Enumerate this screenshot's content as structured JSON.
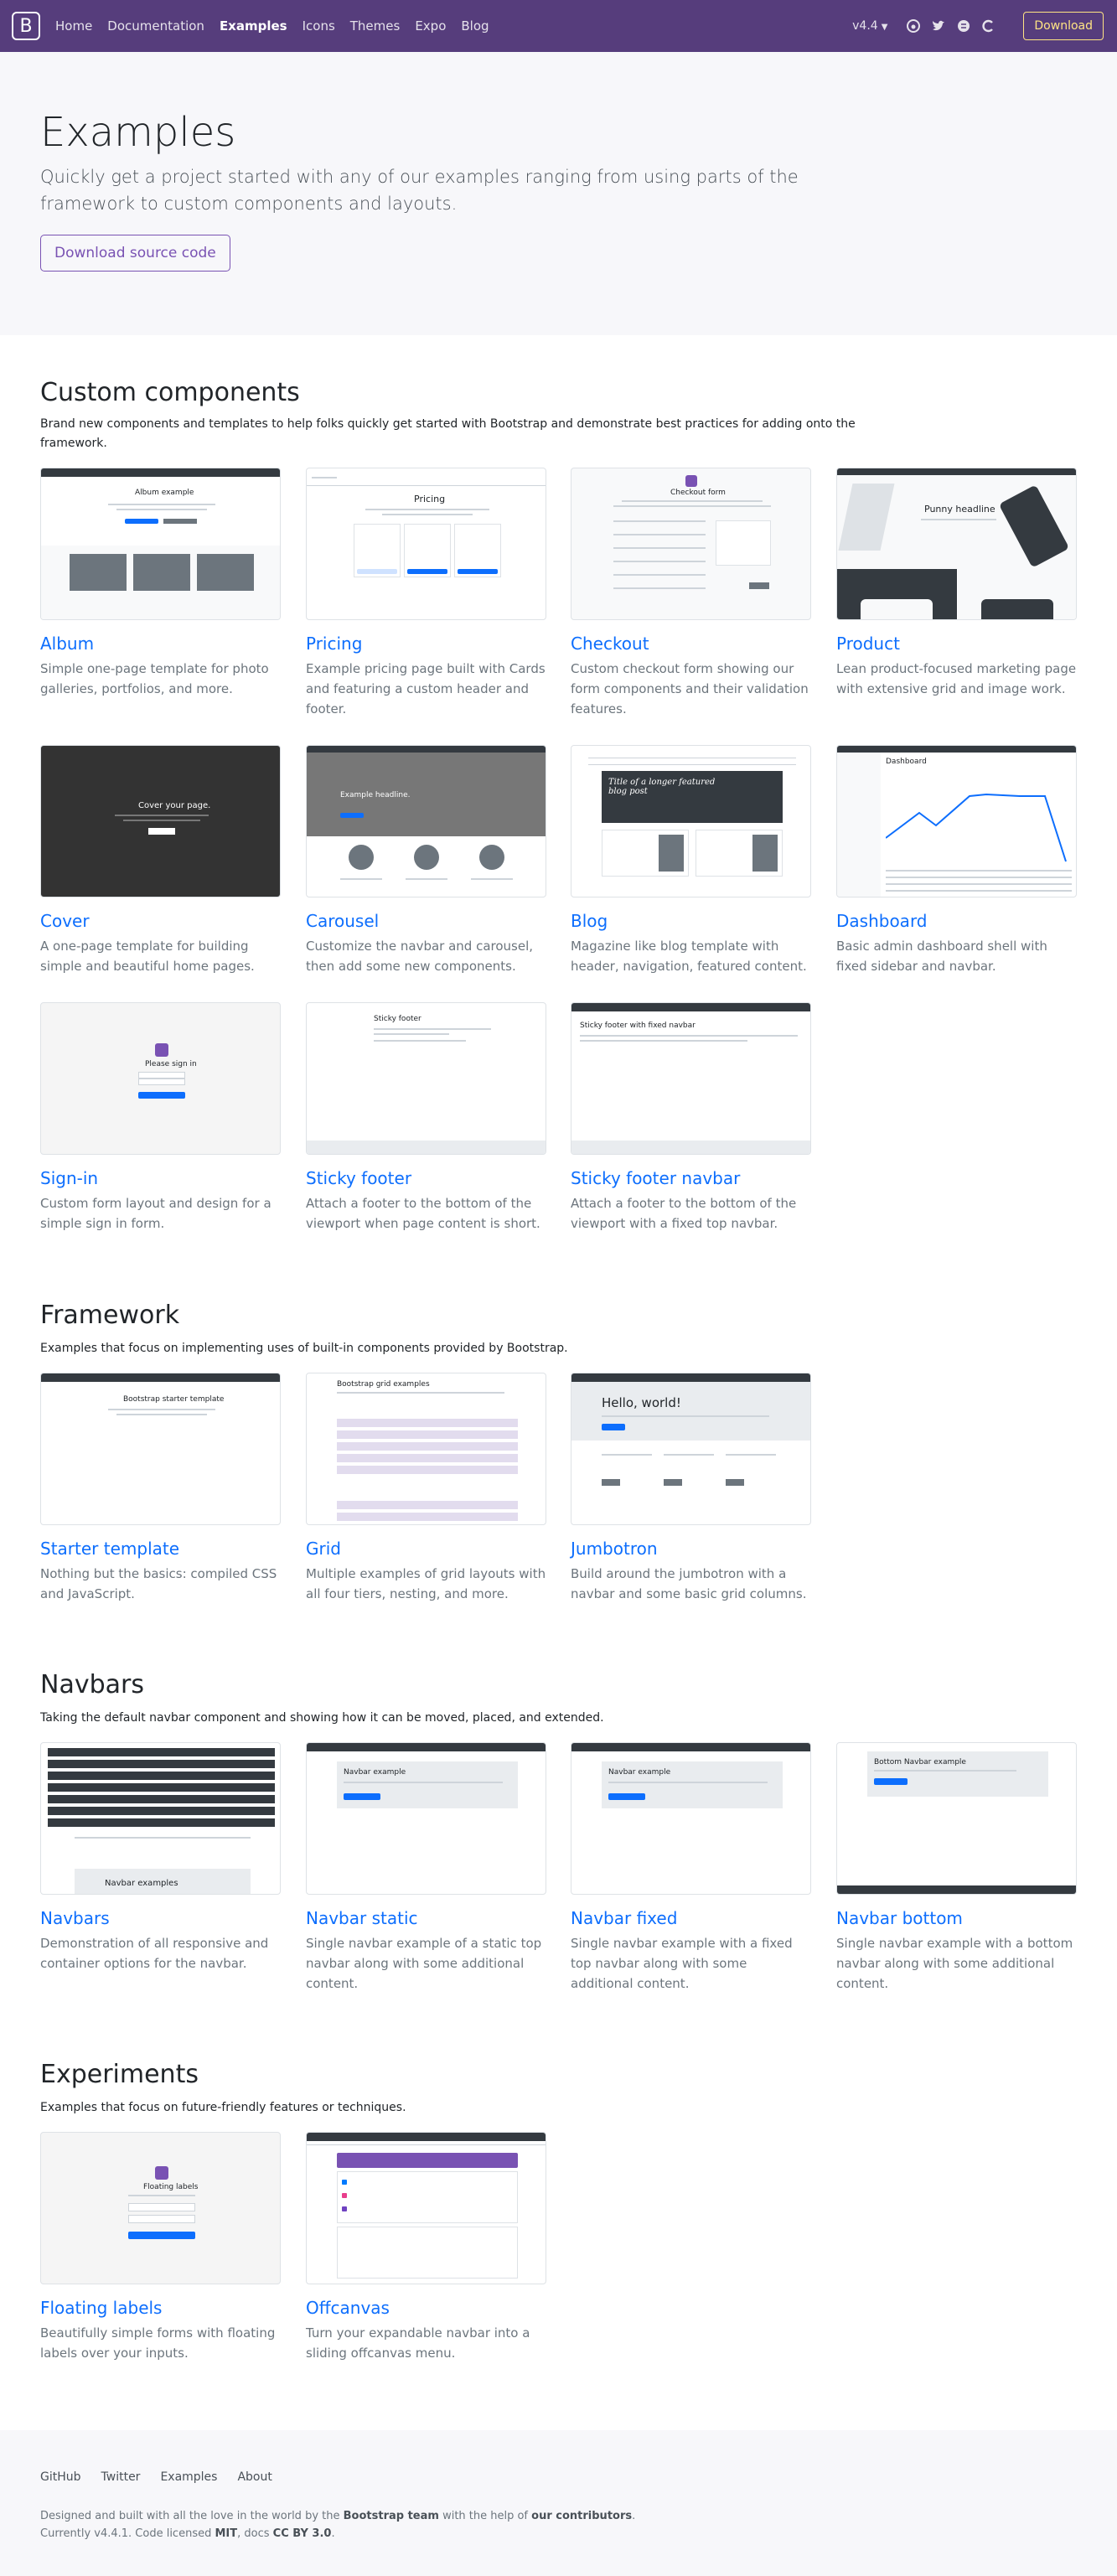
{
  "navbar": {
    "brand": "B",
    "links": [
      "Home",
      "Documentation",
      "Examples",
      "Icons",
      "Themes",
      "Expo",
      "Blog"
    ],
    "version": "v4.4",
    "download": "Download"
  },
  "hero": {
    "title": "Examples",
    "lead": "Quickly get a project started with any of our examples ranging from using parts of the framework to custom components and layouts.",
    "button": "Download source code"
  },
  "sections": {
    "custom": {
      "title": "Custom components",
      "desc": "Brand new components and templates to help folks quickly get started with Bootstrap and demonstrate best practices for adding onto the framework.",
      "cards": [
        {
          "title": "Album",
          "desc": "Simple one-page template for photo galleries, portfolios, and more."
        },
        {
          "title": "Pricing",
          "desc": "Example pricing page built with Cards and featuring a custom header and footer."
        },
        {
          "title": "Checkout",
          "desc": "Custom checkout form showing our form components and their validation features."
        },
        {
          "title": "Product",
          "desc": "Lean product-focused marketing page with extensive grid and image work."
        },
        {
          "title": "Cover",
          "desc": "A one-page template for building simple and beautiful home pages."
        },
        {
          "title": "Carousel",
          "desc": "Customize the navbar and carousel, then add some new components."
        },
        {
          "title": "Blog",
          "desc": "Magazine like blog template with header, navigation, featured content."
        },
        {
          "title": "Dashboard",
          "desc": "Basic admin dashboard shell with fixed sidebar and navbar."
        },
        {
          "title": "Sign-in",
          "desc": "Custom form layout and design for a simple sign in form."
        },
        {
          "title": "Sticky footer",
          "desc": "Attach a footer to the bottom of the viewport when page content is short."
        },
        {
          "title": "Sticky footer navbar",
          "desc": "Attach a footer to the bottom of the viewport with a fixed top navbar."
        }
      ]
    },
    "framework": {
      "title": "Framework",
      "desc": "Examples that focus on implementing uses of built-in components provided by Bootstrap.",
      "cards": [
        {
          "title": "Starter template",
          "desc": "Nothing but the basics: compiled CSS and JavaScript."
        },
        {
          "title": "Grid",
          "desc": "Multiple examples of grid layouts with all four tiers, nesting, and more."
        },
        {
          "title": "Jumbotron",
          "desc": "Build around the jumbotron with a navbar and some basic grid columns."
        }
      ]
    },
    "navbars": {
      "title": "Navbars",
      "desc": "Taking the default navbar component and showing how it can be moved, placed, and extended.",
      "cards": [
        {
          "title": "Navbars",
          "desc": "Demonstration of all responsive and container options for the navbar."
        },
        {
          "title": "Navbar static",
          "desc": "Single navbar example of a static top navbar along with some additional content."
        },
        {
          "title": "Navbar fixed",
          "desc": "Single navbar example with a fixed top navbar along with some additional content."
        },
        {
          "title": "Navbar bottom",
          "desc": "Single navbar example with a bottom navbar along with some additional content."
        }
      ]
    },
    "experiments": {
      "title": "Experiments",
      "desc": "Examples that focus on future-friendly features or techniques.",
      "cards": [
        {
          "title": "Floating labels",
          "desc": "Beautifully simple forms with floating labels over your inputs."
        },
        {
          "title": "Offcanvas",
          "desc": "Turn your expandable navbar into a sliding offcanvas menu."
        }
      ]
    }
  },
  "thumbs": {
    "album": "Album example",
    "pricing": "Pricing",
    "checkout": "Checkout form",
    "product": "Punny headline",
    "cover": "Cover your page.",
    "carousel": "Example headline.",
    "blog": "Title of a longer featured blog post",
    "dashboard": "Dashboard",
    "signin": "Please sign in",
    "sticky": "Sticky footer",
    "stickynav": "Sticky footer with fixed navbar",
    "starter": "Bootstrap starter template",
    "grid": "Bootstrap grid examples",
    "jumbotron": "Hello, world!",
    "navbars": "Navbar examples",
    "navstatic": "Navbar example",
    "navfixed": "Navbar example",
    "navbottom": "Bottom Navbar example",
    "floating": "Floating labels"
  },
  "footer": {
    "links": [
      "GitHub",
      "Twitter",
      "Examples",
      "About"
    ],
    "line1_a": "Designed and built with all the love in the world by the ",
    "line1_b": "Bootstrap team",
    "line1_c": " with the help of ",
    "line1_d": "our contributors",
    "line1_e": ".",
    "line2_a": "Currently v4.4.1. Code licensed ",
    "line2_b": "MIT",
    "line2_c": ", docs ",
    "line2_d": "CC BY 3.0",
    "line2_e": "."
  }
}
